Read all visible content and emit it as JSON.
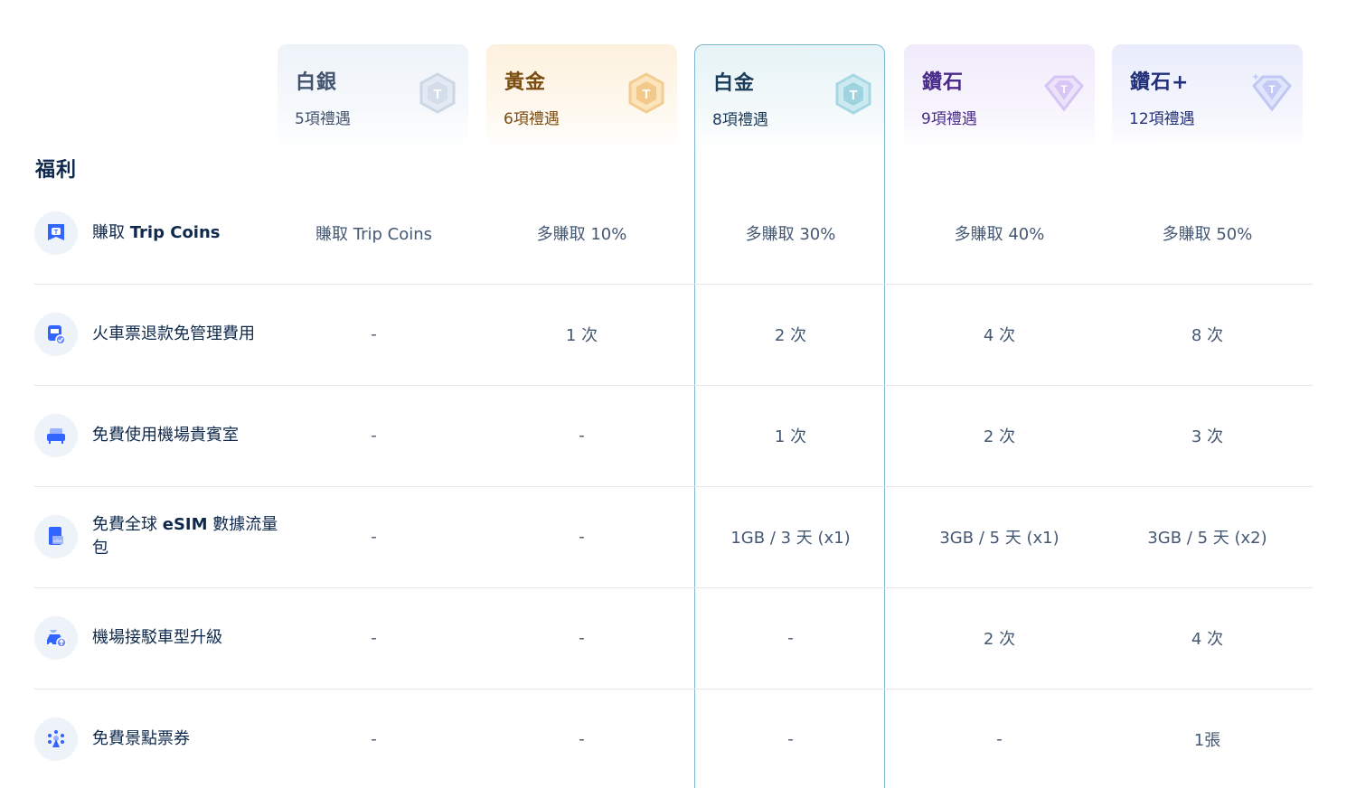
{
  "tiers": [
    {
      "name": "白銀",
      "count": "5項禮遇"
    },
    {
      "name": "黃金",
      "count": "6項禮遇"
    },
    {
      "name": "白金",
      "count": "8項禮遇"
    },
    {
      "name": "鑽石",
      "count": "9項禮遇"
    },
    {
      "name": "鑽石+",
      "count": "12項禮遇"
    }
  ],
  "section_title": "福利",
  "benefits": [
    {
      "label_a": "賺取 ",
      "label_b": "Trip Coins",
      "icon": "trip-coin-icon",
      "values": [
        "賺取 Trip Coins",
        "多賺取 10%",
        "多賺取 30%",
        "多賺取 40%",
        "多賺取 50%"
      ]
    },
    {
      "label_a": "火車票退款免管理費用",
      "label_b": "",
      "icon": "train-ticket-icon",
      "values": [
        "-",
        "1 次",
        "2 次",
        "4 次",
        "8 次"
      ]
    },
    {
      "label_a": "免費使用機場貴賓室",
      "label_b": "",
      "icon": "lounge-sofa-icon",
      "values": [
        "-",
        "-",
        "1 次",
        "2 次",
        "3 次"
      ]
    },
    {
      "label_a": "免費全球 ",
      "label_b": "eSIM",
      "label_c": " 數據流量包",
      "icon": "esim-card-icon",
      "values": [
        "-",
        "-",
        "1GB / 3 天 (x1)",
        "3GB / 5 天 (x1)",
        "3GB / 5 天 (x2)"
      ]
    },
    {
      "label_a": "機場接駁車型升級",
      "label_b": "",
      "icon": "car-upgrade-icon",
      "values": [
        "-",
        "-",
        "-",
        "2 次",
        "4 次"
      ]
    },
    {
      "label_a": "免費景點票券",
      "label_b": "",
      "icon": "attraction-ticket-icon",
      "values": [
        "-",
        "-",
        "-",
        "-",
        "1張"
      ]
    }
  ]
}
